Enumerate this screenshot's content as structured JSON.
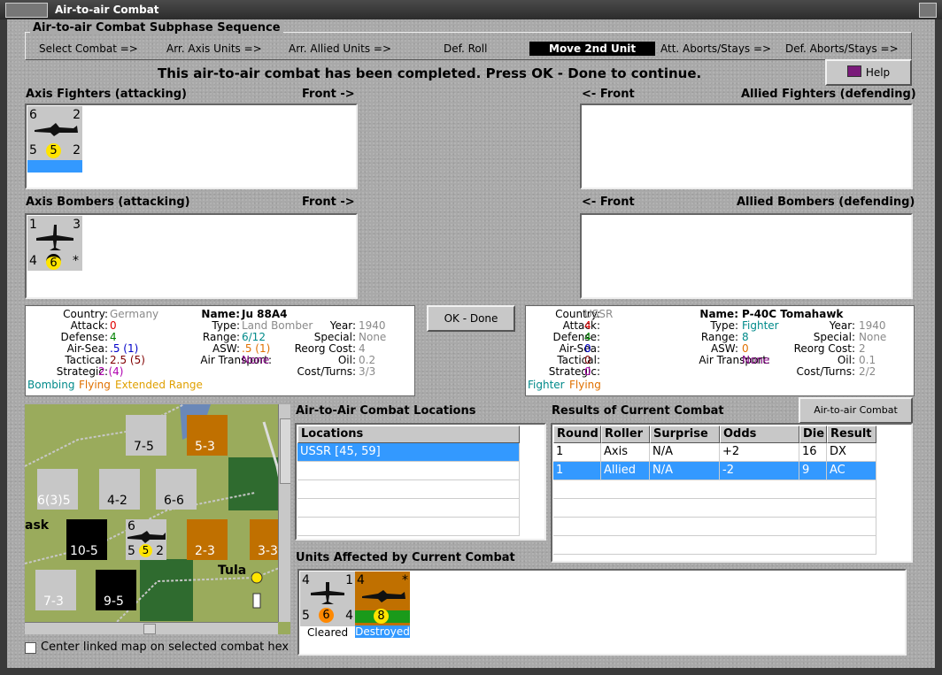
{
  "window": {
    "title": "Air-to-air Combat"
  },
  "subphase": {
    "title": "Air-to-air Combat Subphase Sequence",
    "steps": [
      "Select Combat =>",
      "Arr. Axis Units =>",
      "Arr. Allied Units =>",
      "Def. Roll",
      "Move 2nd Unit",
      "Att. Aborts/Stays =>",
      "Def. Aborts/Stays =>"
    ],
    "active": "Move 2nd Unit"
  },
  "message": "This air-to-air combat has been completed.  Press OK - Done to continue.",
  "help_label": "Help",
  "panels": {
    "axis_fighters": "Axis Fighters (attacking)",
    "axis_fighters_front": "Front ->",
    "allied_fighters_front": "<- Front",
    "allied_fighters": "Allied Fighters (defending)",
    "axis_bombers": "Axis Bombers (attacking)",
    "axis_bombers_front": "Front ->",
    "allied_bombers_front": "<- Front",
    "allied_bombers": "Allied Bombers (defending)"
  },
  "axis_fighter_unit": {
    "tl": "6",
    "tr": "2",
    "bl": "5",
    "coin": "5",
    "br": "2"
  },
  "axis_bomber_unit": {
    "tl": "1",
    "tr": "3",
    "bl": "4",
    "coin": "6",
    "br": "*"
  },
  "ok_label": "OK - Done",
  "left_info": {
    "labels": {
      "country": "Country:",
      "attack": "Attack:",
      "defense": "Defense:",
      "airsea": "Air-Sea:",
      "tactical": "Tactical:",
      "strategic": "Strategic:",
      "name": "Name:",
      "type": "Type:",
      "range": "Range:",
      "asw": "ASW:",
      "air_transport": "Air Transport:",
      "year": "Year:",
      "special": "Special:",
      "reorg": "Reorg Cost:",
      "oil": "Oil:",
      "cost_turns": "Cost/Turns:"
    },
    "country": "Germany",
    "attack": "0",
    "defense": "4",
    "airsea": ".5 (1)",
    "tactical": "2.5 (5)",
    "strategic": "2 (4)",
    "name": "Ju 88A4",
    "type": "Land Bomber",
    "range": "6/12",
    "asw": ".5 (1)",
    "air_transport": "None",
    "year": "1940",
    "special": "None",
    "reorg": "4",
    "oil": "0.2",
    "cost_turns": "3/3",
    "tags": [
      "Bombing",
      "Flying",
      "Extended Range"
    ]
  },
  "right_info": {
    "labels": {
      "country": "Country:",
      "attack": "Attack:",
      "defense": "Defense:",
      "airsea": "Air-Sea:",
      "tactical": "Tactical:",
      "strategic": "Strategic:",
      "name": "Name:",
      "type": "Type:",
      "range": "Range:",
      "asw": "ASW:",
      "air_transport": "Air Transport:",
      "year": "Year:",
      "special": "Special:",
      "reorg": "Reorg Cost:",
      "oil": "Oil:",
      "cost_turns": "Cost/Turns:"
    },
    "country": "USSR",
    "attack": "4",
    "defense": "4",
    "airsea": "0",
    "tactical": "0",
    "strategic": "0",
    "name": "P-40C Tomahawk",
    "type": "Fighter",
    "range": "8",
    "asw": "0",
    "air_transport": "None",
    "year": "1940",
    "special": "None",
    "reorg": "2",
    "oil": "0.1",
    "cost_turns": "2/2",
    "tags": [
      "Fighter",
      "Flying"
    ]
  },
  "locations": {
    "title": "Air-to-Air Combat Locations",
    "header": "Locations",
    "items": [
      "USSR [45, 59]"
    ]
  },
  "results": {
    "title": "Results of Current Combat",
    "chart_button": "Air-to-air Combat Chart",
    "columns": [
      "Round",
      "Roller",
      "Surprise",
      "Odds",
      "Die",
      "Result"
    ],
    "rows": [
      [
        "1",
        "Axis",
        "N/A",
        "+2",
        "16",
        "DX"
      ],
      [
        "1",
        "Allied",
        "N/A",
        "-2",
        "9",
        "AC"
      ]
    ]
  },
  "affected": {
    "title": "Units Affected by Current Combat",
    "units": [
      {
        "tl": "4",
        "tr": "1",
        "bl": "5",
        "coin": "6",
        "br": "4",
        "status": "Cleared"
      },
      {
        "tl": "4",
        "tr": "*",
        "coin": "8",
        "status": "Destroyed"
      }
    ]
  },
  "map": {
    "place": "Tula",
    "place2": "ask",
    "counters": [
      {
        "label": "7-5",
        "top": "2"
      },
      {
        "label": "5-3",
        "top": "2"
      },
      {
        "label": "6(3)5",
        "top": ""
      },
      {
        "label": "4-2",
        "top": ""
      },
      {
        "label": "6-6",
        "top": "2"
      },
      {
        "label": "10-5",
        "top": "3"
      },
      {
        "label": "2-3",
        "top": "2"
      },
      {
        "label": "3-3",
        "top": ""
      },
      {
        "label": "7-3",
        "top": "2"
      },
      {
        "label": "9-5",
        "top": "3"
      }
    ],
    "stack": {
      "tl": "6",
      "bl": "5",
      "coin": "5",
      "br": "2"
    },
    "misc": [
      "2",
      "6",
      "2",
      "4",
      "3",
      "3",
      "5",
      "2",
      "3",
      "2"
    ]
  },
  "checkbox_label": "Center linked map on selected combat hex",
  "colors": {
    "gray_value": "#8a8a8a",
    "red": "#e00000",
    "green": "#008000",
    "blue": "#0000c8",
    "orange": "#e07000",
    "magenta": "#b000b0",
    "purple": "#800080",
    "teal": "#008a8a",
    "selection": "#3399ff"
  }
}
